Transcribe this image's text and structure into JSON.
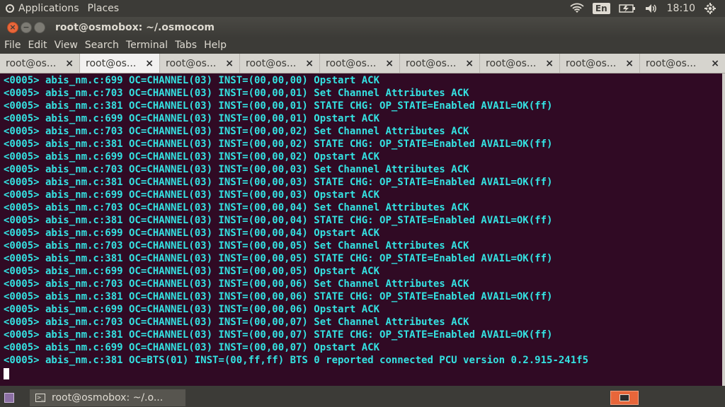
{
  "top_panel": {
    "applications": "Applications",
    "places": "Places",
    "keyboard_layout": "En",
    "clock": "18:10"
  },
  "window": {
    "title": "root@osmobox: ~/.osmocom",
    "close_icon": "close-icon",
    "minimize_icon": "minimize-icon",
    "maximize_icon": "maximize-icon"
  },
  "menubar": {
    "items": [
      "File",
      "Edit",
      "View",
      "Search",
      "Terminal",
      "Tabs",
      "Help"
    ]
  },
  "tabs": [
    {
      "label": "root@os...",
      "active": false
    },
    {
      "label": "root@os...",
      "active": true
    },
    {
      "label": "root@os...",
      "active": false
    },
    {
      "label": "root@os...",
      "active": false
    },
    {
      "label": "root@os...",
      "active": false
    },
    {
      "label": "root@os...",
      "active": false
    },
    {
      "label": "root@os...",
      "active": false
    },
    {
      "label": "root@os...",
      "active": false
    },
    {
      "label": "root@os...",
      "active": false
    }
  ],
  "tab_close_glyph": "×",
  "terminal": {
    "lines": [
      "<0005> abis_nm.c:699 OC=CHANNEL(03) INST=(00,00,00) Opstart ACK",
      "<0005> abis_nm.c:703 OC=CHANNEL(03) INST=(00,00,01) Set Channel Attributes ACK",
      "<0005> abis_nm.c:381 OC=CHANNEL(03) INST=(00,00,01) STATE CHG: OP_STATE=Enabled AVAIL=OK(ff)",
      "<0005> abis_nm.c:699 OC=CHANNEL(03) INST=(00,00,01) Opstart ACK",
      "<0005> abis_nm.c:703 OC=CHANNEL(03) INST=(00,00,02) Set Channel Attributes ACK",
      "<0005> abis_nm.c:381 OC=CHANNEL(03) INST=(00,00,02) STATE CHG: OP_STATE=Enabled AVAIL=OK(ff)",
      "<0005> abis_nm.c:699 OC=CHANNEL(03) INST=(00,00,02) Opstart ACK",
      "<0005> abis_nm.c:703 OC=CHANNEL(03) INST=(00,00,03) Set Channel Attributes ACK",
      "<0005> abis_nm.c:381 OC=CHANNEL(03) INST=(00,00,03) STATE CHG: OP_STATE=Enabled AVAIL=OK(ff)",
      "<0005> abis_nm.c:699 OC=CHANNEL(03) INST=(00,00,03) Opstart ACK",
      "<0005> abis_nm.c:703 OC=CHANNEL(03) INST=(00,00,04) Set Channel Attributes ACK",
      "<0005> abis_nm.c:381 OC=CHANNEL(03) INST=(00,00,04) STATE CHG: OP_STATE=Enabled AVAIL=OK(ff)",
      "<0005> abis_nm.c:699 OC=CHANNEL(03) INST=(00,00,04) Opstart ACK",
      "<0005> abis_nm.c:703 OC=CHANNEL(03) INST=(00,00,05) Set Channel Attributes ACK",
      "<0005> abis_nm.c:381 OC=CHANNEL(03) INST=(00,00,05) STATE CHG: OP_STATE=Enabled AVAIL=OK(ff)",
      "<0005> abis_nm.c:699 OC=CHANNEL(03) INST=(00,00,05) Opstart ACK",
      "<0005> abis_nm.c:703 OC=CHANNEL(03) INST=(00,00,06) Set Channel Attributes ACK",
      "<0005> abis_nm.c:381 OC=CHANNEL(03) INST=(00,00,06) STATE CHG: OP_STATE=Enabled AVAIL=OK(ff)",
      "<0005> abis_nm.c:699 OC=CHANNEL(03) INST=(00,00,06) Opstart ACK",
      "<0005> abis_nm.c:703 OC=CHANNEL(03) INST=(00,00,07) Set Channel Attributes ACK",
      "<0005> abis_nm.c:381 OC=CHANNEL(03) INST=(00,00,07) STATE CHG: OP_STATE=Enabled AVAIL=OK(ff)",
      "<0005> abis_nm.c:699 OC=CHANNEL(03) INST=(00,00,07) Opstart ACK",
      "<0005> abis_nm.c:381 OC=BTS(01) INST=(00,ff,ff) BTS 0 reported connected PCU version 0.2.915-241f5"
    ],
    "text_color": "#34e2e2",
    "background_color": "#300a24"
  },
  "taskbar": {
    "window_label": "root@osmobox: ~/.o...",
    "accent_color": "#e8663a"
  }
}
